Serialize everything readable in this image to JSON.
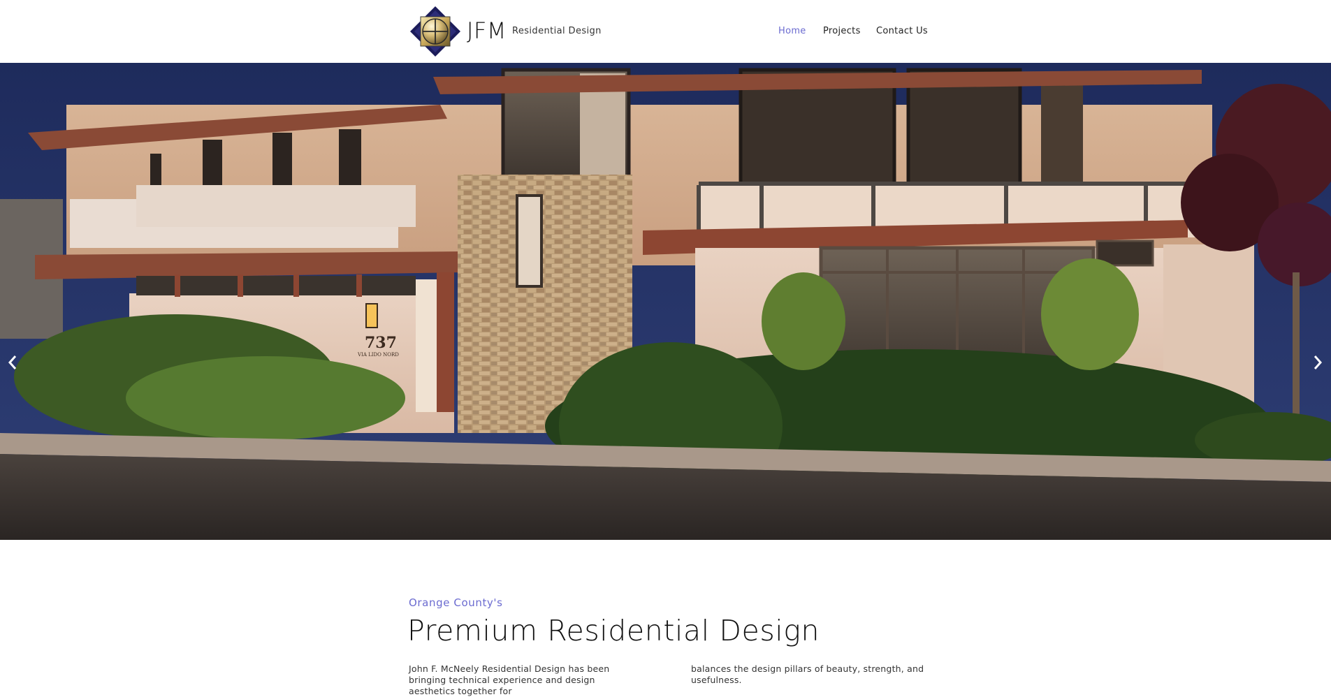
{
  "header": {
    "brand": "JFM",
    "tagline": "Residential Design",
    "logo_icon": "jfm-diamond-logo",
    "nav": [
      {
        "label": "Home",
        "active": true
      },
      {
        "label": "Projects",
        "active": false
      },
      {
        "label": "Contact Us",
        "active": false
      }
    ]
  },
  "hero": {
    "house_number": "737",
    "street_sign": "VIA LIDO NORD",
    "prev_icon": "chevron-left-icon",
    "next_icon": "chevron-right-icon"
  },
  "intro": {
    "kicker": "Orange County's",
    "headline": "Premium Residential Design",
    "column_1": "John F. McNeely Residential Design has been bringing technical experience and design aesthetics together for",
    "column_2": "balances the design pillars of beauty, strength, and usefulness."
  },
  "colors": {
    "accent": "#6b6bd0",
    "text": "#1a1a1a",
    "background": "#ffffff"
  }
}
